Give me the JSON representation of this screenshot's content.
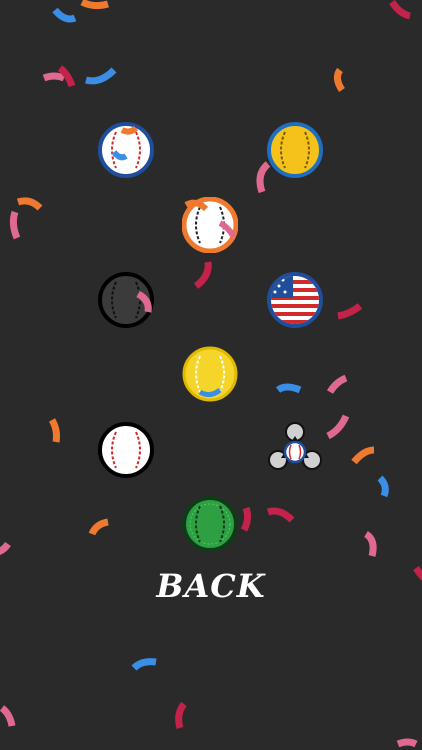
{
  "screen": {
    "back_label": "BACK"
  },
  "balls": [
    {
      "id": "ball-classic-blue",
      "colors": {
        "face": "#ffffff",
        "rim": "#1f4e9c",
        "stitch": "#d12a2a"
      }
    },
    {
      "id": "ball-gold-blue",
      "colors": {
        "face": "#f4c21b",
        "rim": "#1f6fc1",
        "stitch": "#222222"
      }
    },
    {
      "id": "ball-orange",
      "colors": {
        "face": "#ffffff",
        "rim": "#ef7a2f",
        "stitch": "#222222"
      }
    },
    {
      "id": "ball-dark",
      "colors": {
        "face": "#3b3b3b",
        "rim": "#000000",
        "stitch": "#111111"
      }
    },
    {
      "id": "ball-usa",
      "colors": {
        "face": "#ffffff",
        "rim": "#1f4e9c",
        "stitch": "#d12a2a"
      }
    },
    {
      "id": "ball-yellow",
      "colors": {
        "face": "#f6d52a",
        "rim": "#d9b300",
        "stitch": "#ffffff"
      }
    },
    {
      "id": "ball-white-black",
      "colors": {
        "face": "#ffffff",
        "rim": "#000000",
        "stitch": "#d12a2a"
      }
    },
    {
      "id": "ball-spinner",
      "colors": {
        "face": "#ffffff",
        "rim": "#1f4e9c",
        "stitch": "#d12a2a"
      }
    },
    {
      "id": "ball-green",
      "colors": {
        "face": "#2ea043",
        "rim": "#0f3b18",
        "stitch": "#0f3b18"
      }
    }
  ],
  "confetti_colors": [
    "#ef7a2f",
    "#3a8ee6",
    "#e06a8f",
    "#c3224a"
  ]
}
